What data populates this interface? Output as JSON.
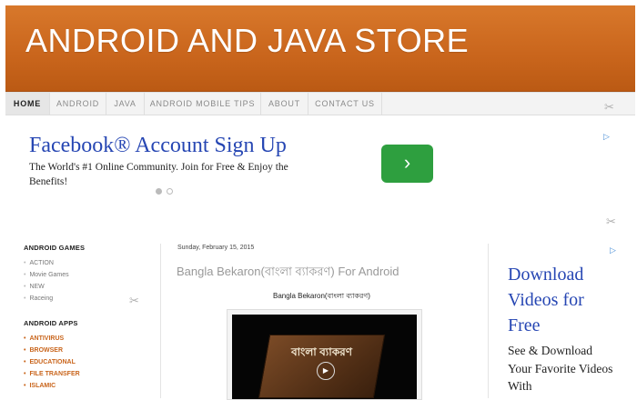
{
  "header": {
    "title": "ANDROID AND JAVA STORE"
  },
  "nav": {
    "items": [
      "HOME",
      "ANDROID",
      "JAVA",
      "ANDROID MOBILE TIPS",
      "ABOUT",
      "CONTACT US"
    ]
  },
  "ad_banner": {
    "headline": "Facebook® Account Sign Up",
    "body": "The World's #1 Online Community. Join for Free & Enjoy the Benefits!",
    "next_glyph": "›"
  },
  "sidebar": {
    "games_heading": "ANDROID GAMES",
    "games": [
      "ACTION",
      "Movie Games",
      "NEW",
      "Raceing"
    ],
    "apps_heading": "ANDROID APPS",
    "apps": [
      "ANTIVIRUS",
      "BROWSER",
      "EDUCATIONAL",
      "FILE TRANSFER",
      "ISLAMIC"
    ]
  },
  "post": {
    "date": "Sunday, February 15, 2015",
    "title": "Bangla Bekaron(বাংলা ব্যাকরণ) For Android",
    "subtitle": "Bangla Bekaron(বাংলা ব্যাকরণ)",
    "video_caption": "বাংলা ব্যাকরণ"
  },
  "ad_side": {
    "headline": "Download Videos for Free",
    "body": "See & Download Your Favorite Videos With"
  },
  "colors": {
    "header_orange": "#c9651c",
    "ad_blue": "#2646b3",
    "ad_green": "#2e9f3f"
  },
  "icons": [
    "wrench-icon",
    "ad-choices-icon",
    "play-icon",
    "chevron-right-icon"
  ]
}
